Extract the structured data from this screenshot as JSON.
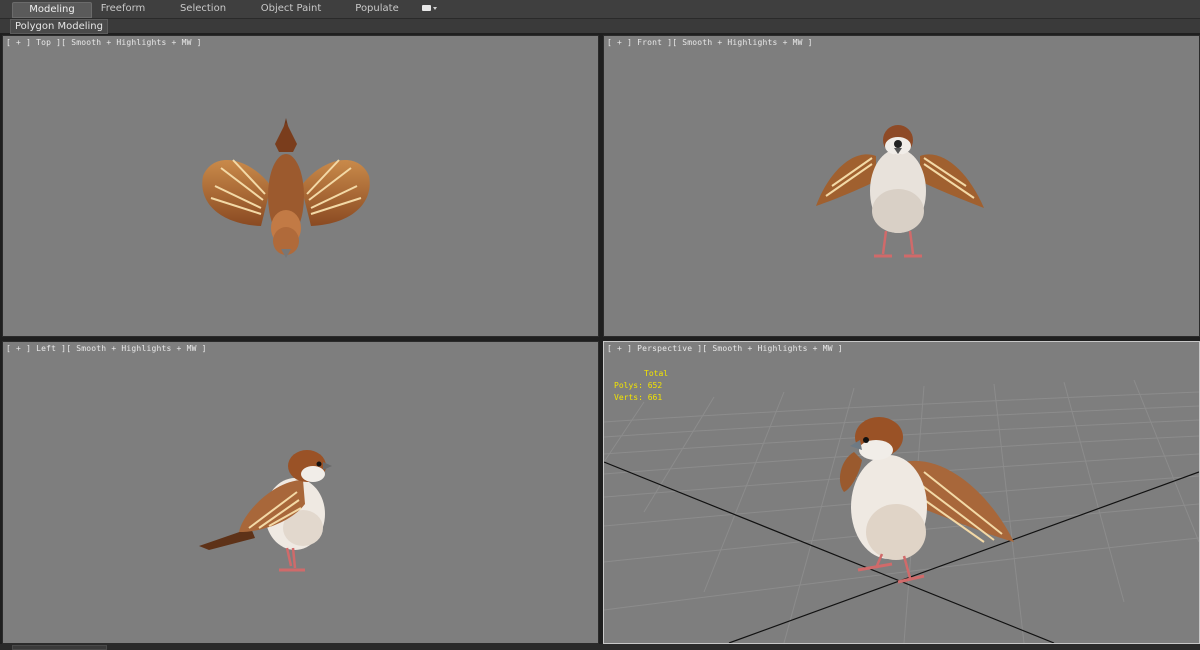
{
  "ribbon": {
    "tabs": [
      {
        "label": "Modeling",
        "active": true
      },
      {
        "label": "Freeform",
        "active": false
      },
      {
        "label": "Selection",
        "active": false
      },
      {
        "label": "Object Paint",
        "active": false
      },
      {
        "label": "Populate",
        "active": false
      }
    ],
    "panel_label": "Polygon Modeling"
  },
  "viewports": {
    "top": {
      "label": "[ + ] Top ][ Smooth + Highlights + MW ]"
    },
    "front": {
      "label": "[ + ] Front ][ Smooth + Highlights + MW ]"
    },
    "left": {
      "label": "[ + ] Left ][ Smooth + Highlights + MW ]"
    },
    "perspective": {
      "label": "[ + ] Perspective ][ Smooth + Highlights + MW ]"
    }
  },
  "stats": {
    "title": "Total",
    "polys_label": "Polys:",
    "polys": "652",
    "verts_label": "Verts:",
    "verts": "661"
  },
  "colors": {
    "viewport_bg": "#7e7e7e",
    "stats_text": "#f2e400",
    "bird_body": "#a8673a",
    "bird_belly": "#efe9e2"
  }
}
